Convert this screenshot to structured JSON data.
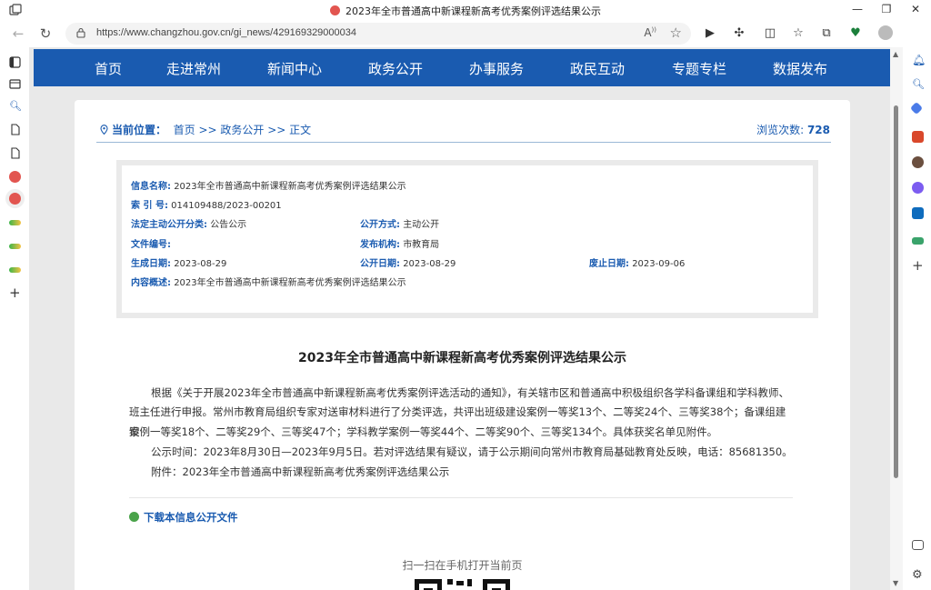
{
  "browser": {
    "tab_title": "2023年全市普通高中新课程新高考优秀案例评选结果公示",
    "url": "https://www.changzhou.gov.cn/gi_news/429169329000034",
    "read_aloud_label": "A",
    "favicon_color": "#e25550"
  },
  "nav": {
    "items": [
      "首页",
      "走进常州",
      "新闻中心",
      "政务公开",
      "办事服务",
      "政民互动",
      "专题专栏",
      "数据发布"
    ],
    "bg_color": "#1a5bb0"
  },
  "breadcrumb": {
    "prefix": "当前位置：",
    "path": "首页 >> 政务公开 >> 正文",
    "views_label": "浏览次数:",
    "views_count": "728"
  },
  "info": {
    "name_label": "信息名称:",
    "name_value": "2023年全市普通高中新课程新高考优秀案例评选结果公示",
    "index_label": "索 引 号:",
    "index_value": "014109488/2023-00201",
    "category_label": "法定主动公开分类:",
    "category_value": "公告公示",
    "method_label": "公开方式:",
    "method_value": "主动公开",
    "docno_label": "文件编号:",
    "docno_value": "",
    "org_label": "发布机构:",
    "org_value": "市教育局",
    "created_label": "生成日期:",
    "created_value": "2023-08-29",
    "published_label": "公开日期:",
    "published_value": "2023-08-29",
    "expiry_label": "废止日期:",
    "expiry_value": "2023-09-06",
    "summary_label": "内容概述:",
    "summary_value": "2023年全市普通高中新课程新高考优秀案例评选结果公示"
  },
  "article": {
    "title": "2023年全市普通高中新课程新高考优秀案例评选结果公示",
    "p1_line1": "根据《关于开展2023年全市普通高中新课程新高考优秀案例评选活动的通知》，有关辖市区和普通高中积极组织各学科备课组和学科教师、",
    "p1_line2": "班主任进行申报。常州市教育局组织专家对送审材料进行了分类评选，共评出班级建设案例一等奖13个、二等奖24个、三等奖38个；备课组建设",
    "p1_line3": "案例一等奖18个、二等奖29个、三等奖47个；学科教学案例一等奖44个、二等奖90个、三等奖134个。具体获奖名单见附件。",
    "p2": "公示时间：2023年8月30日—2023年9月5日。若对评选结果有疑议，请于公示期间向常州市教育局基础教育处反映，电话：85681350。",
    "p3": "附件：2023年全市普通高中新课程新高考优秀案例评选结果公示",
    "download_label": "下载本信息公开文件",
    "qr_caption": "扫一扫在手机打开当前页"
  }
}
